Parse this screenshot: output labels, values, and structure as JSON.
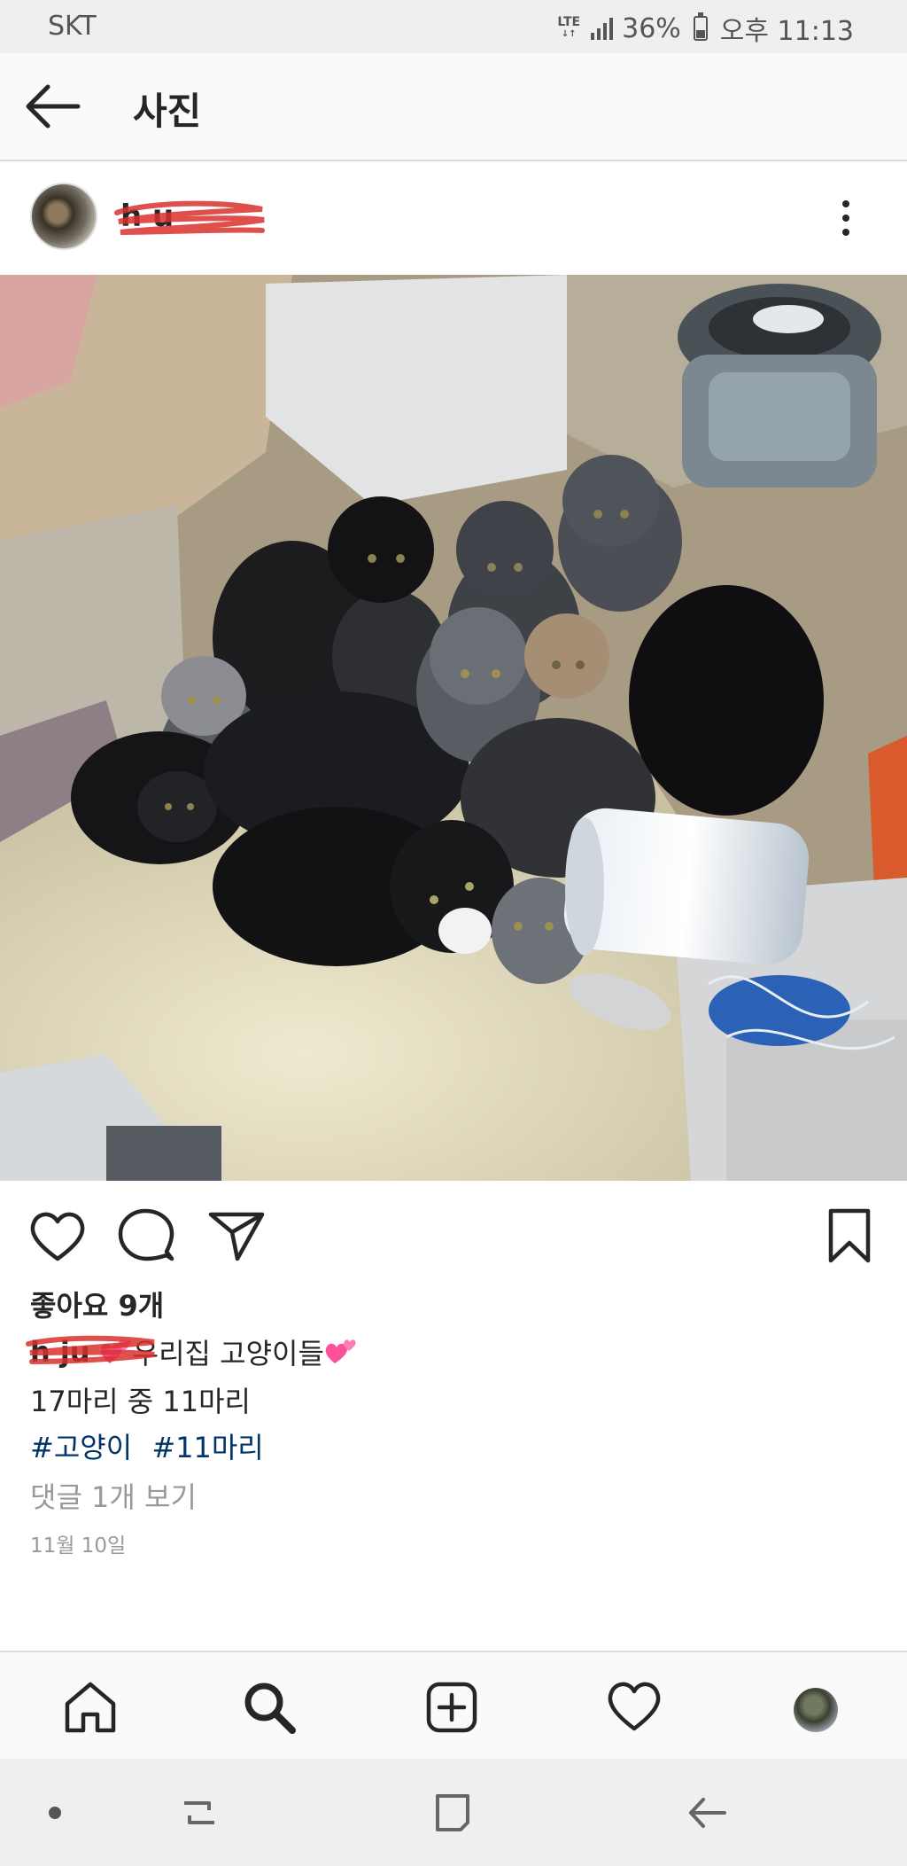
{
  "status_bar": {
    "carrier": "SKT",
    "network": "LTE",
    "battery": "36%",
    "time": "오후 11:13"
  },
  "header": {
    "title": "사진"
  },
  "post": {
    "username": "h      u",
    "photo_alt": "",
    "likes": "좋아요 9개",
    "caption_user": "h      ju",
    "caption_text": "우리집 고양이들",
    "caption_line2": "17마리 중 11마리",
    "hashtags": [
      "#고양이",
      "#11마리"
    ],
    "view_comments": "댓글 1개 보기",
    "date": "11월 10일"
  },
  "icons": {
    "back": "arrow-left-icon",
    "more": "more-vertical-icon",
    "like": "heart-icon",
    "comment": "comment-icon",
    "share": "send-icon",
    "save": "bookmark-icon",
    "home": "home-icon",
    "search": "search-icon",
    "add": "add-post-icon",
    "activity": "heart-icon",
    "profile": "profile-avatar-icon"
  },
  "colors": {
    "hashtag": "#003569",
    "muted": "#999999",
    "scribble": "#d9302c",
    "emoji": "#ff4f9a"
  }
}
